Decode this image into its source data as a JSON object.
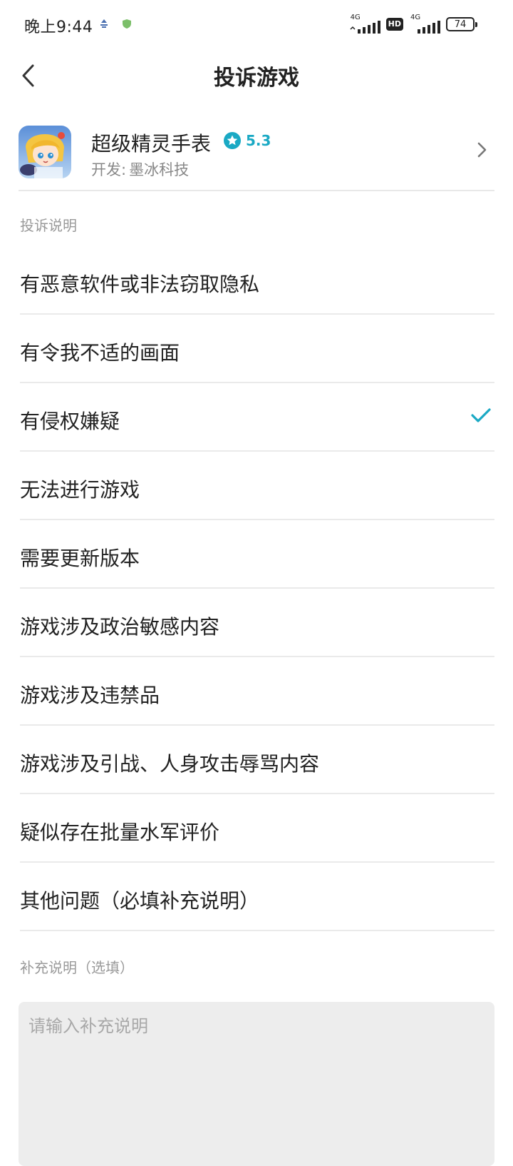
{
  "status_bar": {
    "time": "晚上9:44",
    "network_1": "4G",
    "hd": "HD",
    "network_2": "4G",
    "battery": "74"
  },
  "header": {
    "title": "投诉游戏"
  },
  "game": {
    "name": "超级精灵手表",
    "rating": "5.3",
    "developer_prefix": "开发:",
    "developer": "墨冰科技"
  },
  "section_label": "投诉说明",
  "reasons": [
    {
      "label": "有恶意软件或非法窃取隐私",
      "selected": false
    },
    {
      "label": "有令我不适的画面",
      "selected": false
    },
    {
      "label": "有侵权嫌疑",
      "selected": true
    },
    {
      "label": "无法进行游戏",
      "selected": false
    },
    {
      "label": "需要更新版本",
      "selected": false
    },
    {
      "label": "游戏涉及政治敏感内容",
      "selected": false
    },
    {
      "label": "游戏涉及违禁品",
      "selected": false
    },
    {
      "label": "游戏涉及引战、人身攻击辱骂内容",
      "selected": false
    },
    {
      "label": "疑似存在批量水军评价",
      "selected": false
    },
    {
      "label": "其他问题（必填补充说明）",
      "selected": false
    }
  ],
  "supplement": {
    "label": "补充说明（选填）",
    "placeholder": "请输入补充说明",
    "value": ""
  },
  "colors": {
    "accent": "#1aa9c4",
    "divider": "#eaeaea",
    "input_bg": "#ededed"
  }
}
